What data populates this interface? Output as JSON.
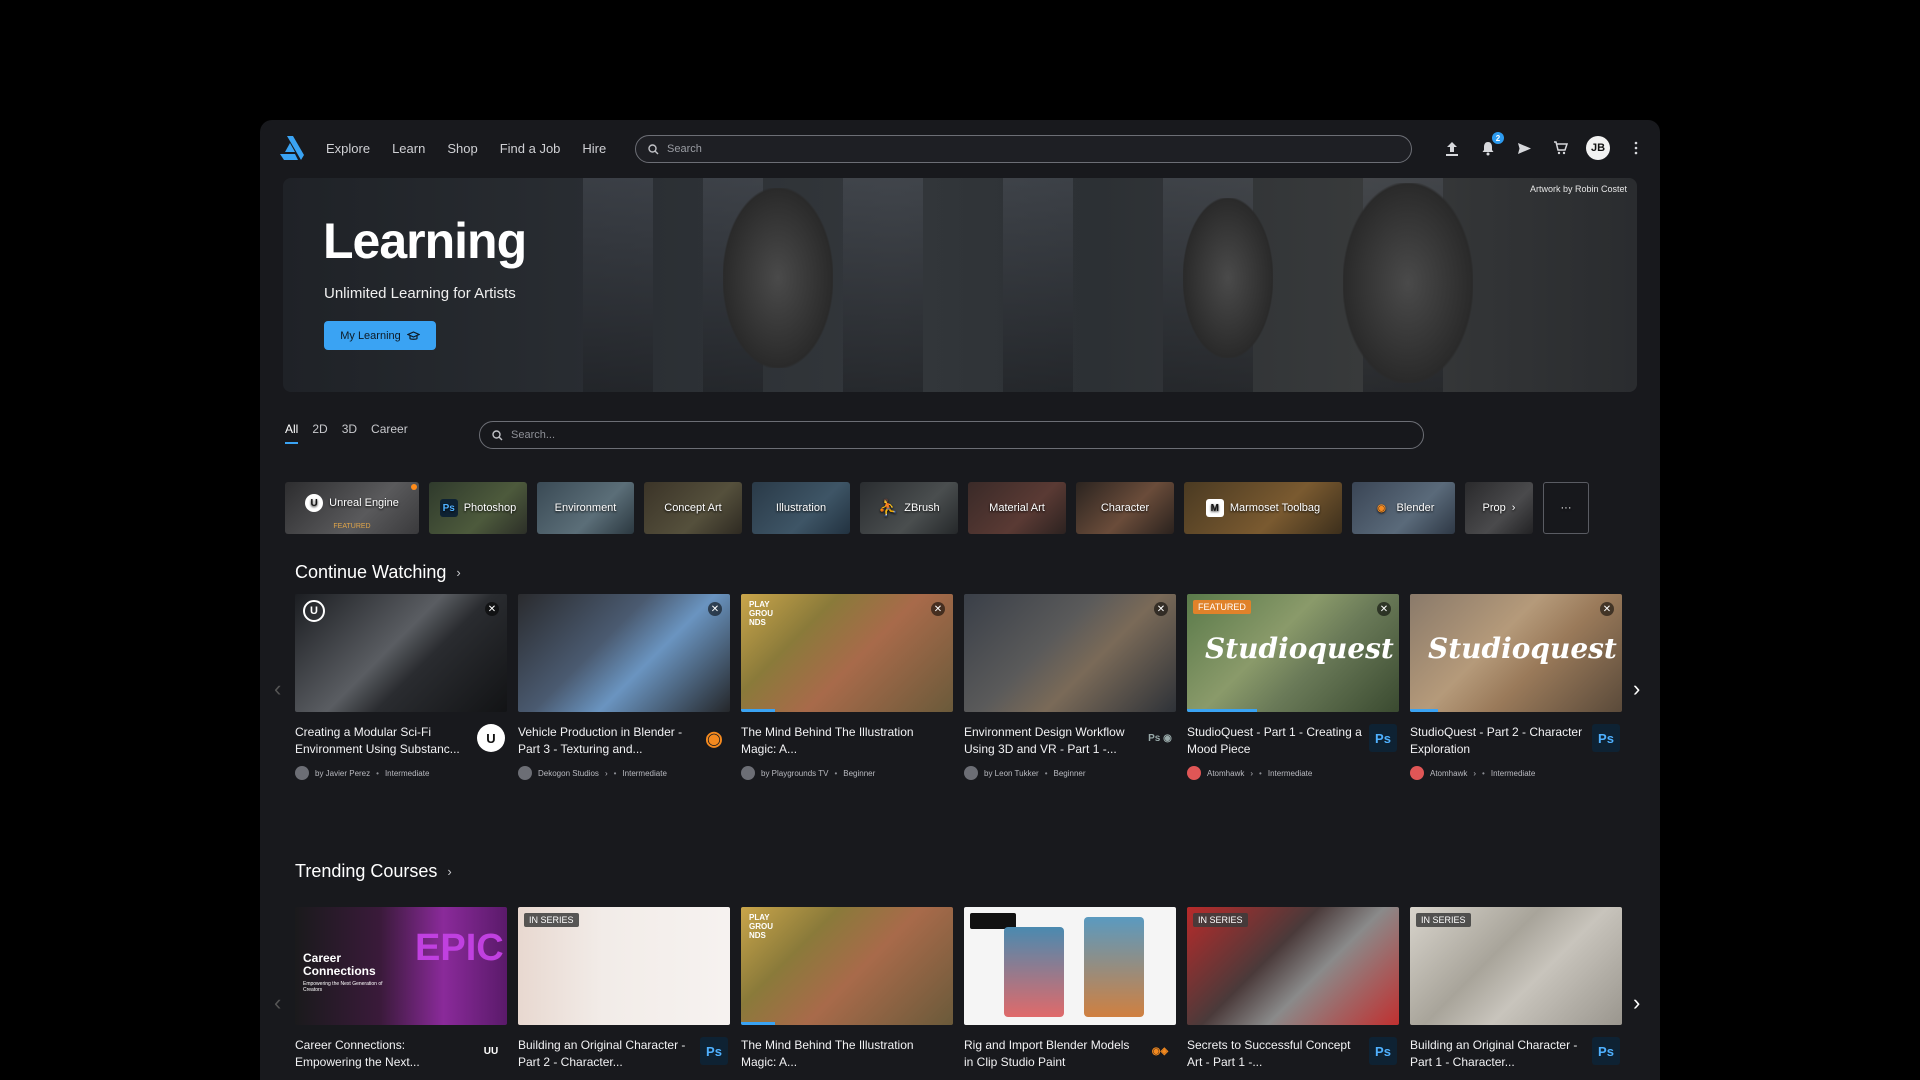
{
  "nav": {
    "links": [
      "Explore",
      "Learn",
      "Shop",
      "Find a Job",
      "Hire"
    ],
    "search_placeholder": "Search",
    "notification_count": "2",
    "avatar_initials": "JB"
  },
  "hero": {
    "title": "Learning",
    "subtitle": "Unlimited Learning for Artists",
    "button_label": "My Learning",
    "credit": "Artwork by Robin Costet"
  },
  "filters": {
    "tabs": [
      "All",
      "2D",
      "3D",
      "Career"
    ],
    "active_tab": "All",
    "search_placeholder": "Search..."
  },
  "categories": [
    {
      "label": "Unreal Engine",
      "sub": "FEATURED",
      "icon": "unreal-icon"
    },
    {
      "label": "Photoshop",
      "icon": "photoshop-icon"
    },
    {
      "label": "Environment"
    },
    {
      "label": "Concept Art"
    },
    {
      "label": "Illustration"
    },
    {
      "label": "ZBrush",
      "icon": "zbrush-icon"
    },
    {
      "label": "Material Art"
    },
    {
      "label": "Character"
    },
    {
      "label": "Marmoset Toolbag",
      "icon": "marmoset-icon"
    },
    {
      "label": "Blender",
      "icon": "blender-icon"
    },
    {
      "label": "Prop"
    }
  ],
  "more_label": "···",
  "continue_watching": {
    "title": "Continue Watching",
    "cards": [
      {
        "title": "Creating a Modular Sci-Fi Environment Using Substanc...",
        "author": "by Javier Perez",
        "level": "Intermediate"
      },
      {
        "title": "Vehicle Production in Blender - Part 3 - Texturing and...",
        "author": "Dekogon Studios",
        "level": "Intermediate"
      },
      {
        "title": "The Mind Behind The Illustration Magic: A...",
        "author": "by Playgrounds TV",
        "level": "Beginner"
      },
      {
        "title": "Environment Design Workflow Using 3D and VR - Part 1 -...",
        "author": "by Leon Tukker",
        "level": "Beginner"
      },
      {
        "title": "StudioQuest - Part 1 - Creating a Mood Piece",
        "author": "Atomhawk",
        "level": "Intermediate",
        "tag": "FEATURED"
      },
      {
        "title": "StudioQuest - Part 2 - Character Exploration",
        "author": "Atomhawk",
        "level": "Intermediate"
      }
    ]
  },
  "trending": {
    "title": "Trending Courses",
    "cards": [
      {
        "title": "Career Connections: Empowering the Next..."
      },
      {
        "title": "Building an Original Character - Part 2 - Character...",
        "tag": "IN SERIES"
      },
      {
        "title": "The Mind Behind The Illustration Magic: A..."
      },
      {
        "title": "Rig and Import Blender Models in Clip Studio Paint"
      },
      {
        "title": "Secrets to Successful Concept Art - Part 1 -...",
        "tag": "IN SERIES"
      },
      {
        "title": "Building an Original Character - Part 1 - Character...",
        "tag": "IN SERIES"
      }
    ]
  },
  "thumb_text": {
    "career": "Career Connections",
    "career_sub": "Empowering the Next Generation of Creators",
    "studioquest": "Studioquest",
    "playgrounds": "PLAY GROU NDS",
    "epic": "EPIC"
  },
  "colors": {
    "accent": "#3aa3f3",
    "background": "#18191d",
    "featured": "#e0822a"
  }
}
